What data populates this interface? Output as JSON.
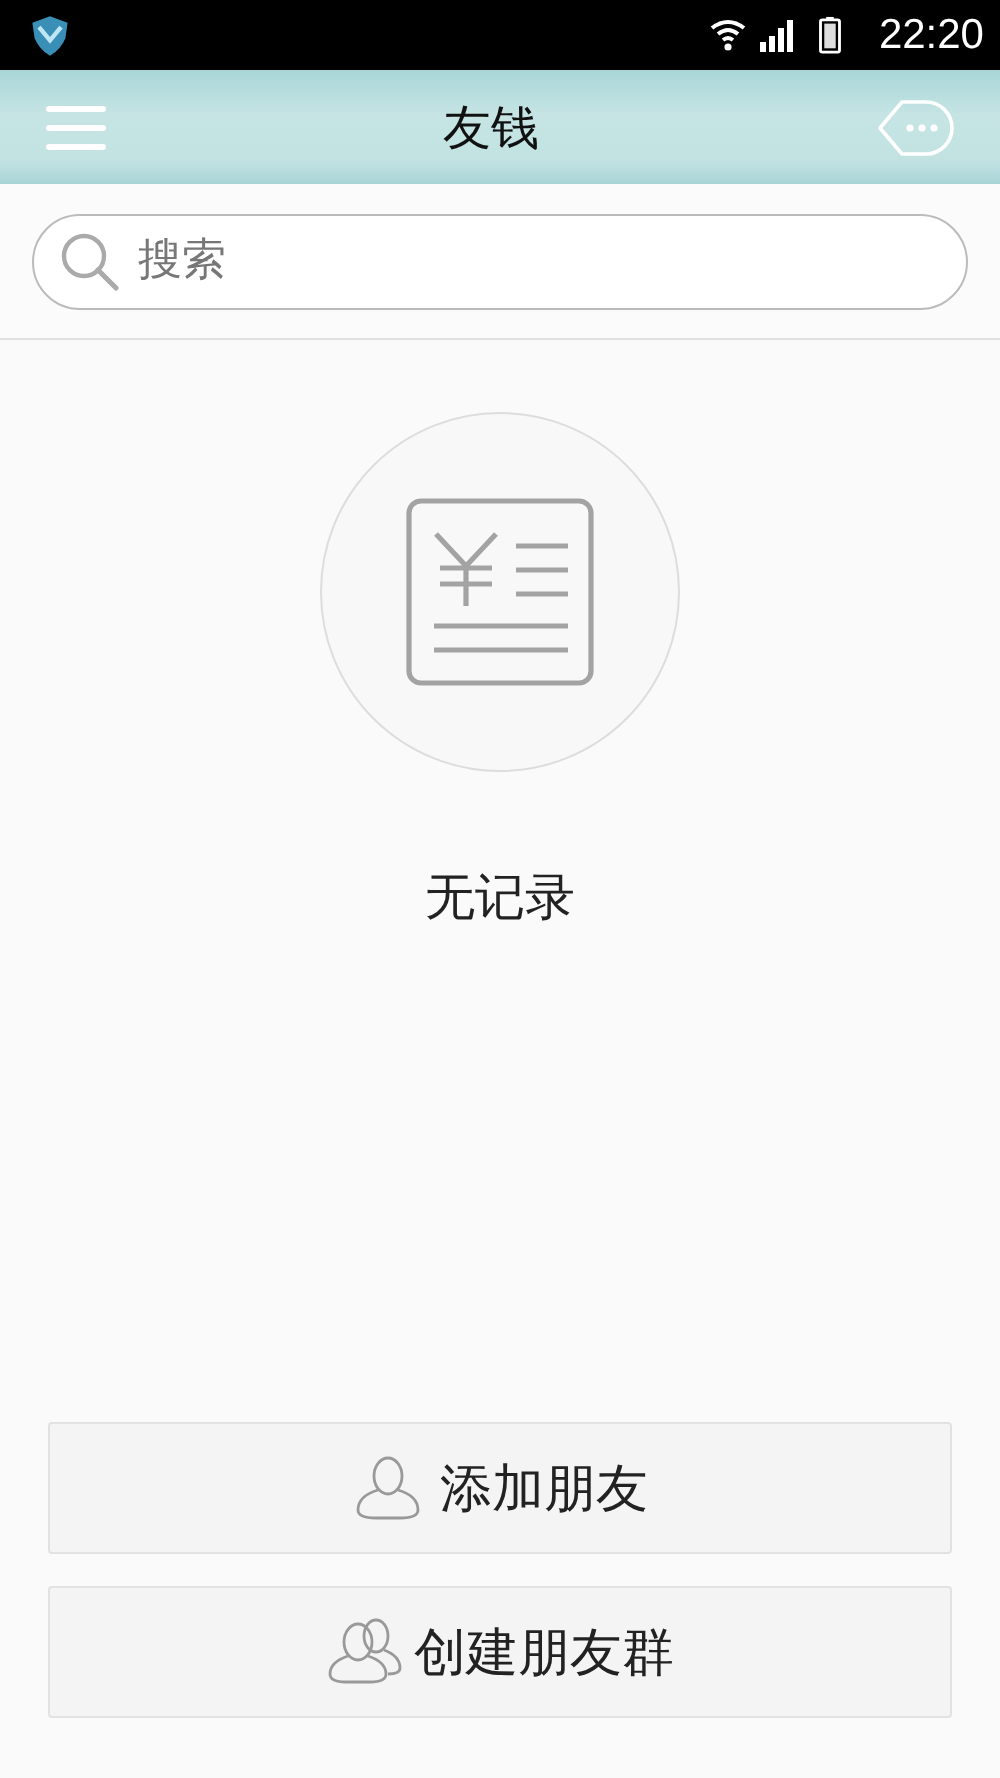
{
  "status_bar": {
    "time": "22:20"
  },
  "header": {
    "title": "友钱"
  },
  "search": {
    "placeholder": "搜索"
  },
  "empty_state": {
    "message": "无记录"
  },
  "buttons": [
    {
      "label": "添加朋友",
      "kind": "person"
    },
    {
      "label": "创建朋友群",
      "kind": "group"
    }
  ]
}
